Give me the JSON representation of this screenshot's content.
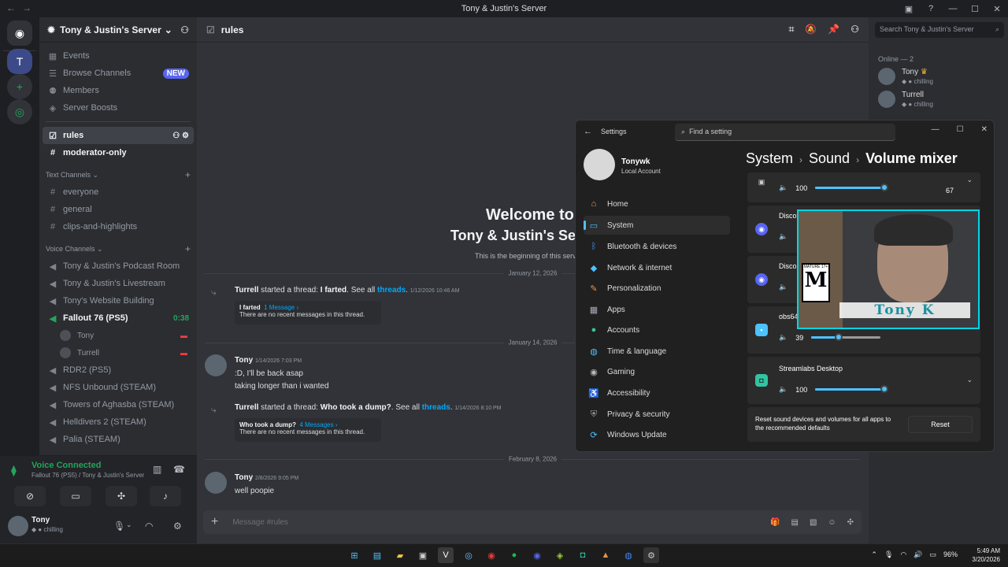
{
  "window": {
    "title": "Tony & Justin's Server"
  },
  "server": {
    "name": "Tony & Justin's Server",
    "menu": [
      {
        "label": "Events",
        "icon": "calendar-icon"
      },
      {
        "label": "Browse Channels",
        "icon": "browse-icon",
        "badge": "NEW"
      },
      {
        "label": "Members",
        "icon": "members-icon"
      },
      {
        "label": "Server Boosts",
        "icon": "boost-icon"
      }
    ],
    "channels": [
      {
        "label": "rules",
        "icon": "rules-icon"
      },
      {
        "label": "moderator-only",
        "icon": "hash-icon"
      }
    ],
    "text_category": "Text Channels",
    "text_channels": [
      "everyone",
      "general",
      "clips-and-highlights"
    ],
    "voice_category": "Voice Channels",
    "voice_channels_top": [
      "Tony & Justin's Podcast Room",
      "Tony & Justin's Livestream",
      "Tony's Website Building"
    ],
    "active_voice": {
      "label": "Fallout 76 (PS5)",
      "timer": "0:38",
      "users": [
        "Tony",
        "Turrell"
      ]
    },
    "voice_channels_bottom": [
      "RDR2 (PS5)",
      "NFS Unbound (STEAM)",
      "Towers of Aghasba (STEAM)",
      "Helldivers 2 (STEAM)",
      "Palia (STEAM)"
    ]
  },
  "voice_panel": {
    "status": "Voice Connected",
    "location": "Fallout 76 (PS5) / Tony & Justin's Server",
    "user": {
      "name": "Tony",
      "status": "chilling"
    }
  },
  "chat": {
    "channel": "rules",
    "welcome_line1": "Welcome to",
    "welcome_line2": "Tony & Justin's Se",
    "welcome_sub": "This is the beginning of this serv",
    "dates": [
      "January 12, 2026",
      "January 14, 2026",
      "February 8, 2026"
    ],
    "threads": [
      {
        "author": "Turrell",
        "action": "started a thread:",
        "title": "I farted",
        "see_all": "See all",
        "threads_word": "threads",
        "time": "1/12/2026 10:46 AM",
        "count": "1 Message ›",
        "empty": "There are no recent messages in this thread."
      },
      {
        "author": "Turrell",
        "action": "started a thread:",
        "title": "Who took a dump?",
        "see_all": "See all",
        "threads_word": "threads",
        "time": "1/14/2026 8:10 PM",
        "count": "4 Messages ›",
        "empty": "There are no recent messages in this thread."
      }
    ],
    "messages": [
      {
        "author": "Tony",
        "time": "1/14/2026 7:03 PM",
        "lines": [
          ":D, I'll be back asap",
          "taking longer than i wanted"
        ]
      },
      {
        "author": "Tony",
        "time": "2/8/2026 9:05 PM",
        "lines": [
          "well poopie"
        ]
      }
    ],
    "input_placeholder": "Message #rules"
  },
  "members": {
    "search_placeholder": "Search Tony & Justin's Server",
    "online_header": "Online — 2",
    "list": [
      {
        "name": "Tony",
        "status": "chilling"
      },
      {
        "name": "Turrell",
        "status": "chilling"
      }
    ]
  },
  "settings": {
    "title": "Settings",
    "search_placeholder": "Find a setting",
    "user_name": "Tonywk",
    "account": "Local Account",
    "nav": [
      {
        "label": "Home",
        "icon": "home-icon"
      },
      {
        "label": "System",
        "icon": "system-icon"
      },
      {
        "label": "Bluetooth & devices",
        "icon": "bluetooth-icon"
      },
      {
        "label": "Network & internet",
        "icon": "wifi-icon"
      },
      {
        "label": "Personalization",
        "icon": "brush-icon"
      },
      {
        "label": "Apps",
        "icon": "apps-icon"
      },
      {
        "label": "Accounts",
        "icon": "account-icon"
      },
      {
        "label": "Time & language",
        "icon": "globe-icon"
      },
      {
        "label": "Gaming",
        "icon": "gamepad-icon"
      },
      {
        "label": "Accessibility",
        "icon": "accessibility-icon"
      },
      {
        "label": "Privacy & security",
        "icon": "shield-icon"
      },
      {
        "label": "Windows Update",
        "icon": "update-icon"
      }
    ],
    "breadcrumb": [
      "System",
      "Sound",
      "Volume mixer"
    ],
    "apps": [
      {
        "name": "",
        "volume": 100,
        "level": 67,
        "level_label": "67"
      },
      {
        "name": "Discor",
        "volume": null
      },
      {
        "name": "Discor",
        "volume": null
      },
      {
        "name": "obs64",
        "volume": 39
      },
      {
        "name": "Streamlabs Desktop",
        "volume": 100
      }
    ],
    "reset_text": "Reset sound devices and volumes for all apps to the recommended defaults",
    "reset_label": "Reset"
  },
  "webcam": {
    "name_tag": "Tony K",
    "rating": "M",
    "rating_header": "MATURE 17+"
  },
  "taskbar": {
    "battery": "96%",
    "time": "5:49 AM",
    "date": "3/20/2026"
  },
  "colors": {
    "accent": "#4cc2ff",
    "discord_green": "#23a55a",
    "blurple": "#5865f2"
  }
}
